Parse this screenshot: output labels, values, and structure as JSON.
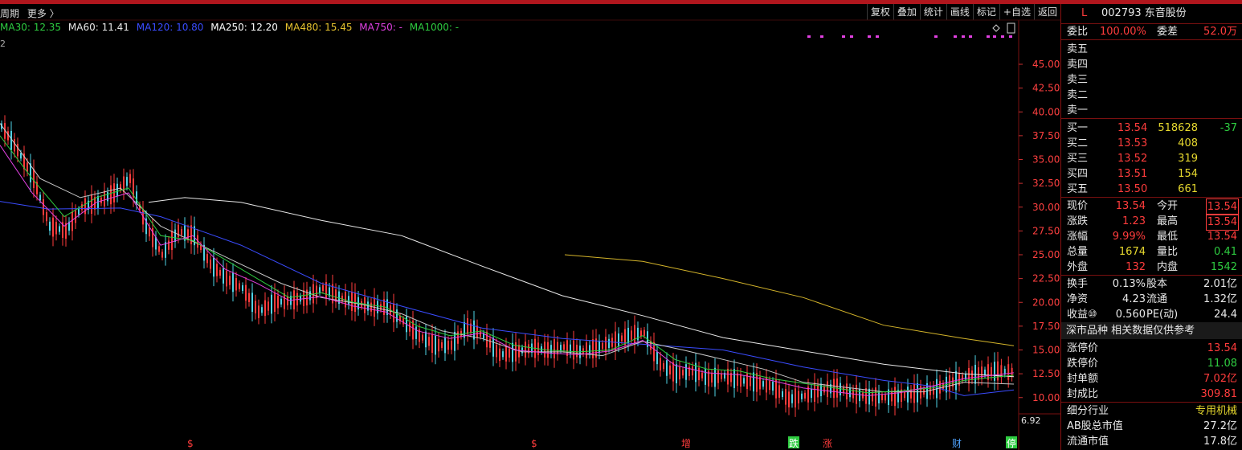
{
  "toolbar": {
    "left_items": [
      "周期",
      "更多 〉"
    ],
    "right_buttons": [
      "复权",
      "叠加",
      "统计",
      "画线",
      "标记",
      "+自选",
      "返回"
    ]
  },
  "ma_legend": [
    {
      "label": "MA30: 12.35",
      "color": "#2ecc40"
    },
    {
      "label": "MA60: 11.41",
      "color": "#e8e8e8"
    },
    {
      "label": "MA120: 10.80",
      "color": "#3a4cff"
    },
    {
      "label": "MA250: 12.20",
      "color": "#ffffff"
    },
    {
      "label": "MA480: 15.45",
      "color": "#e6c22e"
    },
    {
      "label": "MA750: -",
      "color": "#e040e0"
    },
    {
      "label": "MA1000: -",
      "color": "#2ecc40"
    }
  ],
  "row2_label": "2",
  "chart_data": {
    "type": "line",
    "y_ticks": [
      "45.00",
      "42.50",
      "40.00",
      "37.50",
      "35.00",
      "32.50",
      "30.00",
      "27.50",
      "25.00",
      "22.50",
      "20.00",
      "17.50",
      "15.00",
      "12.50",
      "10.00"
    ],
    "y_tick_values": [
      45,
      42.5,
      40,
      37.5,
      35,
      32.5,
      30,
      27.5,
      25,
      22.5,
      20,
      17.5,
      15,
      12.5,
      10
    ],
    "last_low_label": "6.92",
    "series": [
      {
        "name": "MA250",
        "color": "#e8e8e8",
        "x": [
          185,
          230,
          300,
          400,
          500,
          600,
          700,
          800,
          900,
          1000,
          1100,
          1200,
          1262
        ],
        "y": [
          30.5,
          31.0,
          30.5,
          28.6,
          27.0,
          23.8,
          20.7,
          18.6,
          16.3,
          14.9,
          13.5,
          12.5,
          12.2
        ]
      },
      {
        "name": "MA480",
        "color": "#d4b42a",
        "x": [
          703,
          800,
          900,
          1000,
          1100,
          1200,
          1262
        ],
        "y": [
          25.0,
          24.3,
          22.5,
          20.5,
          17.6,
          16.2,
          15.45
        ]
      },
      {
        "name": "MA120",
        "color": "#3a4cff",
        "x": [
          0,
          60,
          150,
          200,
          300,
          400,
          500,
          600,
          700,
          800,
          900,
          1000,
          1100,
          1160,
          1200,
          1262
        ],
        "y": [
          30.6,
          29.8,
          29.9,
          29.0,
          26.0,
          22.0,
          19.6,
          17.3,
          16.2,
          15.6,
          15.0,
          13.2,
          11.8,
          11.2,
          10.2,
          10.8
        ]
      },
      {
        "name": "MA60",
        "color": "#c8c8c8",
        "x": [
          0,
          50,
          100,
          150,
          200,
          250,
          300,
          350,
          400,
          450,
          500,
          550,
          600,
          650,
          700,
          750,
          800,
          850,
          900,
          950,
          1000,
          1050,
          1100,
          1150,
          1200,
          1262
        ],
        "y": [
          38.8,
          33.0,
          31.0,
          32.0,
          28.0,
          26.0,
          24.0,
          22.0,
          20.5,
          19.8,
          18.8,
          17.0,
          16.2,
          14.8,
          14.8,
          14.4,
          15.9,
          15.0,
          14.0,
          13.0,
          11.6,
          11.1,
          10.6,
          10.6,
          11.6,
          11.41
        ]
      },
      {
        "name": "MA30",
        "color": "#2ecc40",
        "x": [
          0,
          40,
          80,
          120,
          160,
          200,
          240,
          280,
          320,
          360,
          400,
          440,
          480,
          520,
          560,
          600,
          640,
          680,
          720,
          760,
          800,
          840,
          880,
          920,
          960,
          1000,
          1040,
          1080,
          1120,
          1160,
          1200,
          1262
        ],
        "y": [
          37.5,
          33.0,
          29.0,
          31.0,
          32.0,
          27.0,
          26.5,
          24.5,
          22.5,
          20.5,
          21.0,
          20.0,
          19.5,
          17.5,
          16.5,
          17.0,
          15.5,
          15.0,
          14.8,
          15.0,
          16.5,
          14.0,
          13.0,
          12.8,
          12.0,
          11.5,
          11.0,
          10.5,
          10.7,
          11.0,
          11.8,
          12.35
        ]
      },
      {
        "name": "MA750",
        "color": "#e040e0",
        "x": [
          0,
          40,
          80,
          120,
          160,
          200,
          240,
          280,
          320,
          360,
          400,
          440,
          480,
          520,
          560,
          600,
          640,
          680,
          720,
          760,
          800,
          840,
          880,
          920,
          960,
          1000,
          1040,
          1080,
          1120,
          1160,
          1200,
          1262
        ],
        "y": [
          36.5,
          31.5,
          28.0,
          30.5,
          31.5,
          26.0,
          27.0,
          23.5,
          22.0,
          20.2,
          20.6,
          19.6,
          19.0,
          17.0,
          16.2,
          16.8,
          15.0,
          14.7,
          14.5,
          14.9,
          16.0,
          13.4,
          12.6,
          12.4,
          11.8,
          11.0,
          10.6,
          10.2,
          10.5,
          11.2,
          12.0,
          12.6
        ]
      },
      {
        "name": "price",
        "color": "#4fd3e6",
        "x": [
          0,
          20,
          40,
          60,
          80,
          100,
          120,
          140,
          160,
          180,
          200,
          220,
          240,
          260,
          280,
          300,
          320,
          340,
          360,
          380,
          400,
          420,
          440,
          460,
          480,
          500,
          520,
          540,
          560,
          580,
          600,
          620,
          640,
          660,
          680,
          700,
          720,
          740,
          760,
          780,
          800,
          820,
          840,
          860,
          880,
          900,
          920,
          940,
          960,
          980,
          1000,
          1020,
          1040,
          1060,
          1080,
          1100,
          1120,
          1140,
          1160,
          1180,
          1200,
          1220,
          1240,
          1262
        ],
        "y": [
          38.5,
          36.0,
          33.0,
          28.0,
          27.5,
          30.0,
          30.5,
          31.5,
          33.0,
          28.0,
          25.0,
          27.5,
          27.0,
          24.0,
          22.5,
          21.5,
          19.0,
          20.0,
          20.2,
          20.5,
          21.5,
          20.5,
          20.0,
          19.5,
          19.5,
          18.0,
          16.5,
          15.5,
          15.5,
          17.5,
          16.5,
          14.5,
          14.8,
          15.2,
          15.0,
          15.3,
          14.8,
          15.2,
          15.8,
          16.5,
          16.8,
          13.5,
          12.5,
          12.8,
          12.0,
          12.3,
          11.8,
          11.6,
          11.2,
          9.8,
          10.2,
          10.8,
          11.0,
          10.4,
          10.1,
          10.0,
          10.2,
          10.5,
          10.8,
          11.5,
          12.2,
          12.6,
          12.8,
          12.6
        ]
      }
    ],
    "bottom_markers": [
      {
        "label": "$",
        "color": "#ff3c3c",
        "x": 238,
        "boxed": false
      },
      {
        "label": "$",
        "color": "#ff3c3c",
        "x": 666,
        "boxed": false
      },
      {
        "label": "增",
        "color": "#ff3c3c",
        "x": 853,
        "boxed": false
      },
      {
        "label": "跌",
        "color": "#2ecc40",
        "x": 987,
        "boxed": true
      },
      {
        "label": "涨",
        "color": "#ff3c3c",
        "x": 1029,
        "boxed": false
      },
      {
        "label": "财",
        "color": "#4fa3ff",
        "x": 1190,
        "boxed": false
      },
      {
        "label": "停",
        "color": "#2ecc40",
        "x": 1258,
        "boxed": true
      }
    ]
  },
  "panel": {
    "marker": "L",
    "code": "002793",
    "name": "东音股份",
    "weibi_label": "委比",
    "weibi_value": "100.00%",
    "weicha_label": "委差",
    "weicha_value": "52.0万",
    "sell": [
      {
        "label": "卖五"
      },
      {
        "label": "卖四"
      },
      {
        "label": "卖三"
      },
      {
        "label": "卖二"
      },
      {
        "label": "卖一"
      }
    ],
    "buy": [
      {
        "label": "买一",
        "price": "13.54",
        "vol": "518628",
        "chg": "-37"
      },
      {
        "label": "买二",
        "price": "13.53",
        "vol": "408",
        "chg": ""
      },
      {
        "label": "买三",
        "price": "13.52",
        "vol": "319",
        "chg": ""
      },
      {
        "label": "买四",
        "price": "13.51",
        "vol": "154",
        "chg": ""
      },
      {
        "label": "买五",
        "price": "13.50",
        "vol": "661",
        "chg": ""
      }
    ],
    "quote": [
      {
        "l1": "现价",
        "v1": "13.54",
        "c1": "red",
        "l2": "今开",
        "v2": "13.54",
        "c2": "red",
        "b2": true
      },
      {
        "l1": "涨跌",
        "v1": "1.23",
        "c1": "red",
        "l2": "最高",
        "v2": "13.54",
        "c2": "red",
        "b2": true
      },
      {
        "l1": "涨幅",
        "v1": "9.99%",
        "c1": "red",
        "l2": "最低",
        "v2": "13.54",
        "c2": "red",
        "b2": false
      },
      {
        "l1": "总量",
        "v1": "1674",
        "c1": "yellow",
        "l2": "量比",
        "v2": "0.41",
        "c2": "green",
        "b2": false
      },
      {
        "l1": "外盘",
        "v1": "132",
        "c1": "red",
        "l2": "内盘",
        "v2": "1542",
        "c2": "green",
        "b2": false
      }
    ],
    "fund": [
      {
        "l1": "换手",
        "v1": "0.13%",
        "l2": "股本",
        "v2": "2.01亿"
      },
      {
        "l1": "净资",
        "v1": "4.23",
        "l2": "流通",
        "v2": "1.32亿"
      },
      {
        "l1": "收益⑩",
        "v1": "0.560",
        "l2": "PE(动)",
        "v2": "24.4"
      }
    ],
    "section_head": "深市品种  相关数据仅供参考",
    "limits": [
      {
        "l": "涨停价",
        "v": "13.54",
        "c": "red"
      },
      {
        "l": "跌停价",
        "v": "11.08",
        "c": "green"
      },
      {
        "l": "封单额",
        "v": "7.02亿",
        "c": "red"
      },
      {
        "l": "封成比",
        "v": "309.81",
        "c": "red"
      }
    ],
    "industry_label": "细分行业",
    "industry_value": "专用机械",
    "ab_label": "AB股总市值",
    "ab_value": "27.2亿",
    "float_label": "流通市值",
    "float_value": "17.8亿"
  }
}
